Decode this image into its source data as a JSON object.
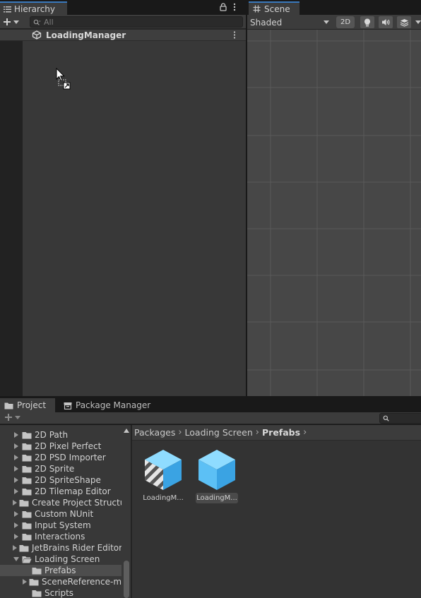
{
  "hierarchy": {
    "tab_label": "Hierarchy",
    "search_placeholder": "All",
    "scene_root_name": "LoadingManager"
  },
  "scene": {
    "tab_label": "Scene",
    "shading_mode": "Shaded",
    "mode_2d_label": "2D"
  },
  "project": {
    "tabs": [
      {
        "label": "Project"
      },
      {
        "label": "Package Manager"
      }
    ],
    "tree": [
      {
        "label": "2D Path",
        "expanded": false,
        "selected": false
      },
      {
        "label": "2D Pixel Perfect",
        "expanded": false,
        "selected": false
      },
      {
        "label": "2D PSD Importer",
        "expanded": false,
        "selected": false
      },
      {
        "label": "2D Sprite",
        "expanded": false,
        "selected": false
      },
      {
        "label": "2D SpriteShape",
        "expanded": false,
        "selected": false
      },
      {
        "label": "2D Tilemap Editor",
        "expanded": false,
        "selected": false
      },
      {
        "label": "Create Project Structu",
        "expanded": false,
        "selected": false
      },
      {
        "label": "Custom NUnit",
        "expanded": false,
        "selected": false
      },
      {
        "label": "Input System",
        "expanded": false,
        "selected": false
      },
      {
        "label": "Interactions",
        "expanded": false,
        "selected": false
      },
      {
        "label": "JetBrains Rider Editor",
        "expanded": false,
        "selected": false
      },
      {
        "label": "Loading Screen",
        "expanded": true,
        "selected": false
      },
      {
        "label": "Prefabs",
        "expanded": false,
        "selected": true
      },
      {
        "label": "SceneReference-m",
        "expanded": false,
        "selected": false
      },
      {
        "label": "Scripts",
        "expanded": false,
        "selected": false
      }
    ],
    "breadcrumb": [
      "Packages",
      "Loading Screen",
      "Prefabs"
    ],
    "assets": [
      {
        "label": "LoadingM...",
        "icon": "prefab-variant-icon",
        "selected": false
      },
      {
        "label": "LoadingM...",
        "icon": "prefab-icon",
        "selected": true
      }
    ]
  }
}
